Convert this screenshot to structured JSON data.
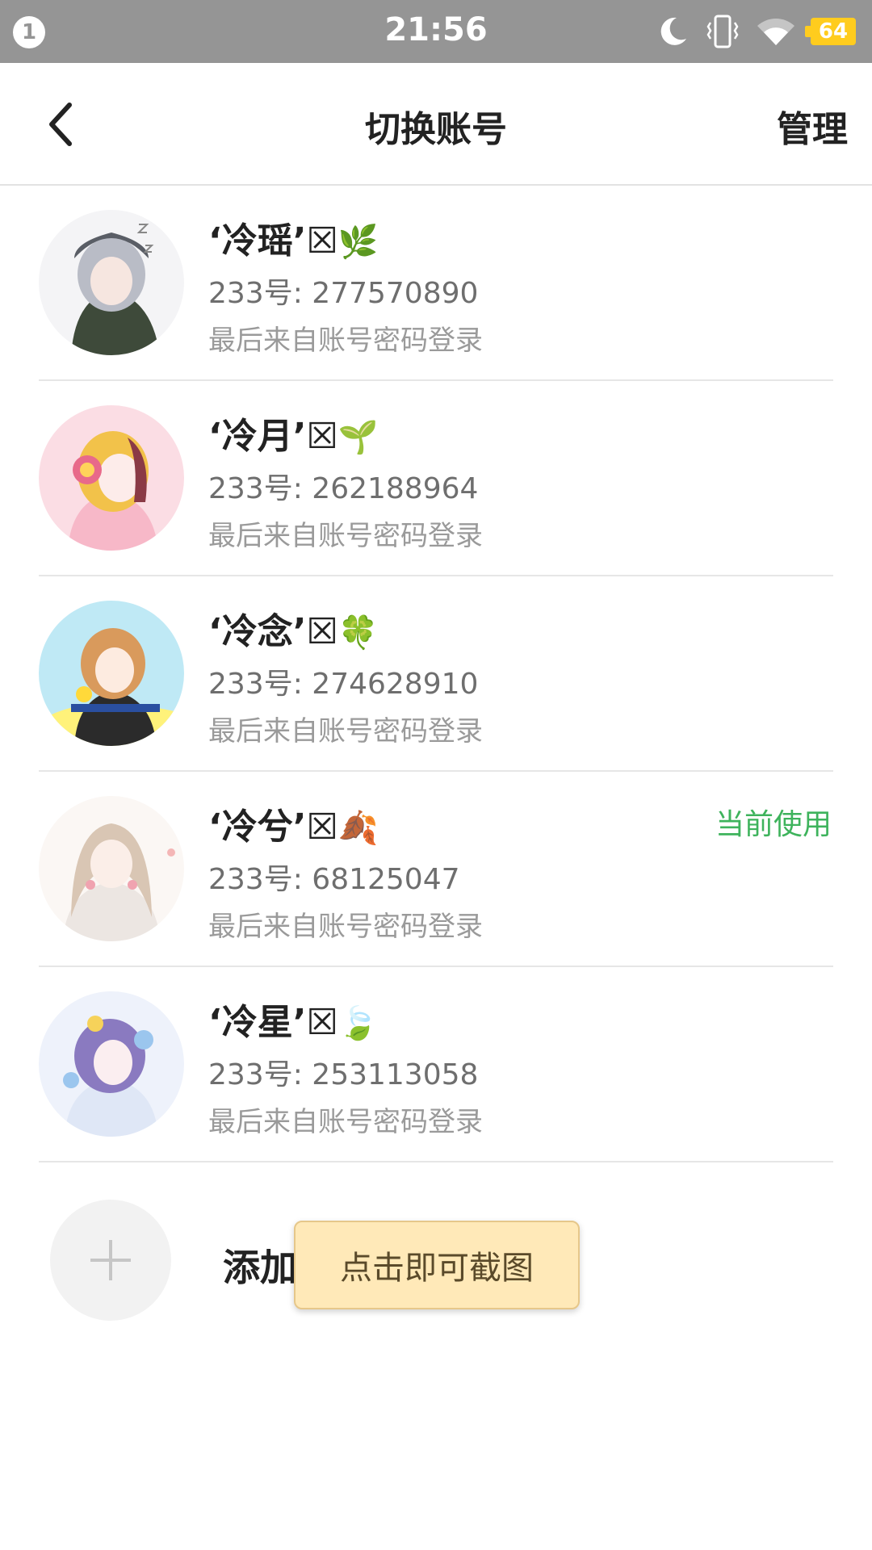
{
  "status_bar": {
    "notification_count": "1",
    "time": "21:56",
    "battery": "64",
    "icons": [
      "moon-icon",
      "vibrate-icon",
      "wifi-icon",
      "battery-icon"
    ],
    "battery_color": "#ffcc1e"
  },
  "header": {
    "back_icon": "chevron-left-icon",
    "title": "切换账号",
    "manage_label": "管理"
  },
  "accounts": [
    {
      "name": "‘冷瑶’☒",
      "emoji": "🌿",
      "id": "233号: 277570890",
      "login": "最后来自账号密码登录",
      "current": ""
    },
    {
      "name": "‘冷月’☒",
      "emoji": "🌱",
      "id": "233号: 262188964",
      "login": "最后来自账号密码登录",
      "current": ""
    },
    {
      "name": "‘冷念’☒",
      "emoji": "🍀",
      "id": "233号: 274628910",
      "login": "最后来自账号密码登录",
      "current": ""
    },
    {
      "name": "‘冷兮’☒",
      "emoji": "🍂",
      "id": "233号: 68125047",
      "login": "最后来自账号密码登录",
      "current": "当前使用"
    },
    {
      "name": "‘冷星’☒",
      "emoji": "🍃",
      "id": "233号: 253113058",
      "login": "最后来自账号密码登录",
      "current": ""
    }
  ],
  "add_account": {
    "label": "添加",
    "icon": "plus-icon"
  },
  "tooltip": {
    "text": "点击即可截图"
  },
  "colors": {
    "status_bar_bg": "#959595",
    "current_badge": "#3eb35c",
    "tooltip_bg": "#ffe9b8"
  }
}
